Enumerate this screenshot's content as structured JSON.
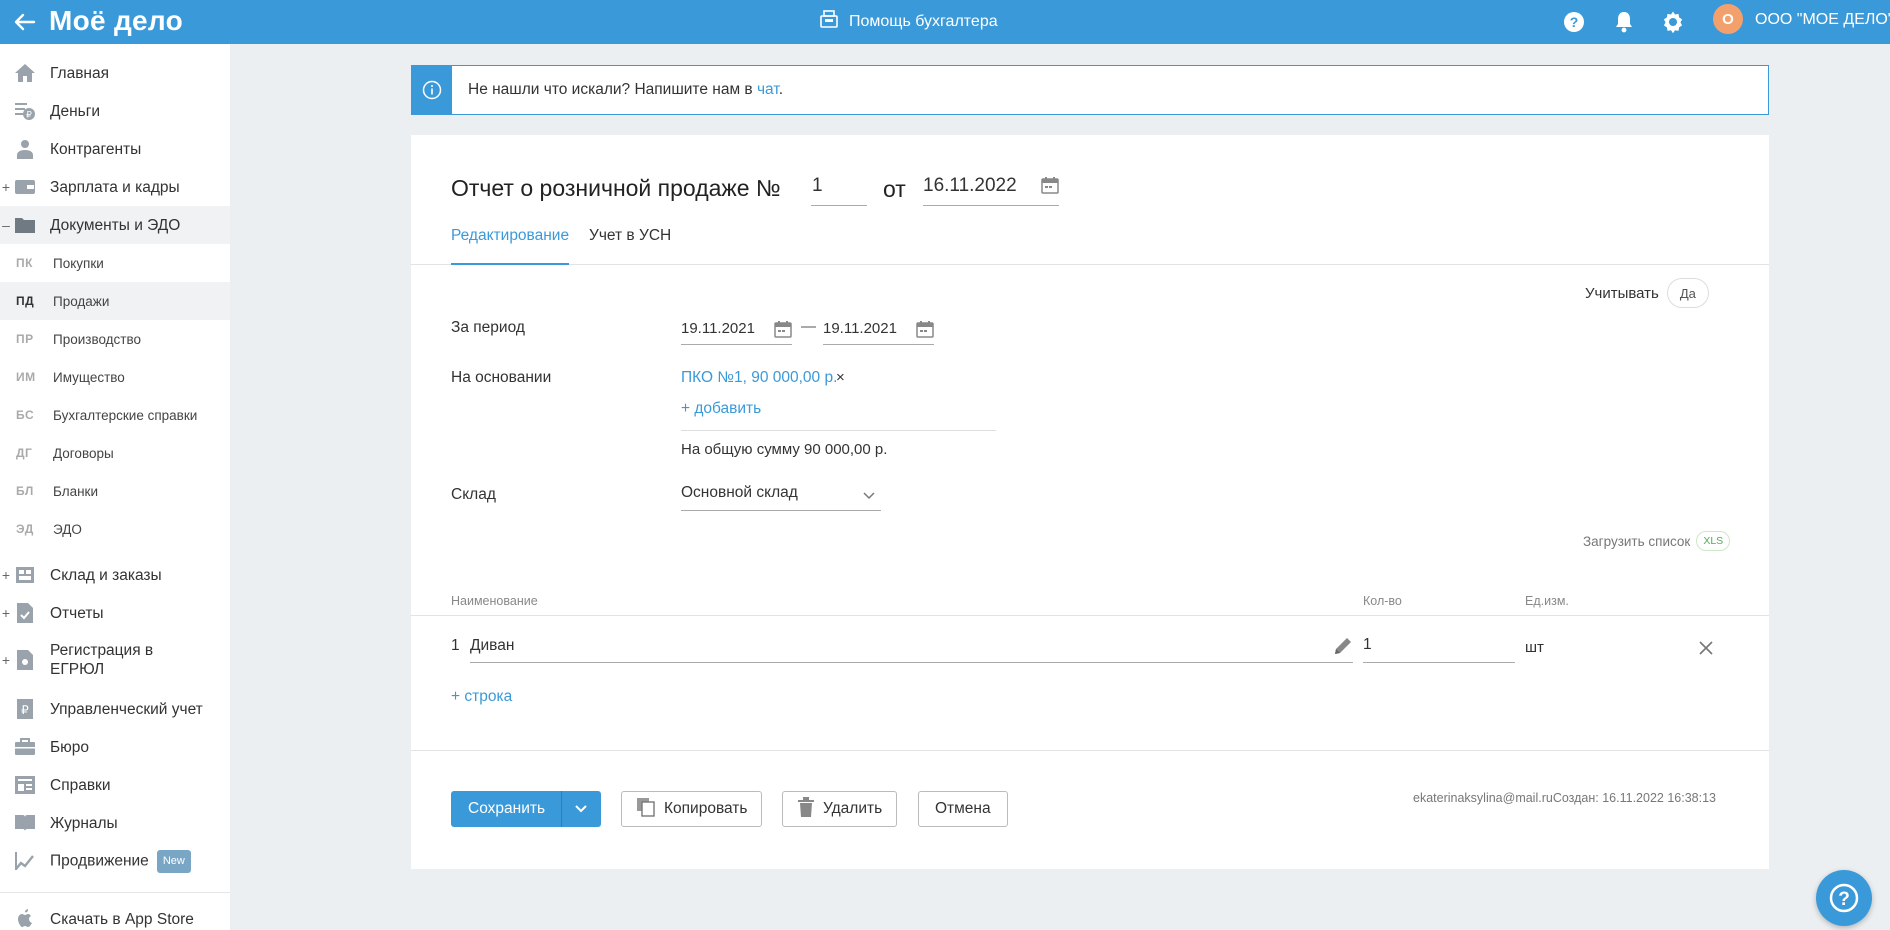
{
  "header": {
    "logo_text": "Моё дело",
    "help_center_label": "Помощь бухгалтера",
    "org_initial": "О",
    "org_name": "ООО \"МОЕ ДЕЛО\"",
    "colors": {
      "topbar": "#3a9ad9",
      "avatar": "#f4a06c"
    }
  },
  "sidebar": {
    "items": [
      {
        "label": "Главная",
        "icon": "home-icon",
        "expandable": false
      },
      {
        "label": "Деньги",
        "icon": "money-icon",
        "expandable": false
      },
      {
        "label": "Контрагенты",
        "icon": "contractors-icon",
        "expandable": false
      },
      {
        "label": "Зарплата и кадры",
        "icon": "wallet-icon",
        "expandable": true
      },
      {
        "label": "Документы и ЭДО",
        "icon": "folder-icon",
        "expandable": true,
        "expanded": true
      }
    ],
    "sub_items": [
      {
        "abbr": "ПК",
        "label": "Покупки"
      },
      {
        "abbr": "ПД",
        "label": "Продажи",
        "active": true
      },
      {
        "abbr": "ПР",
        "label": "Производство"
      },
      {
        "abbr": "ИМ",
        "label": "Имущество"
      },
      {
        "abbr": "БС",
        "label": "Бухгалтерские справки"
      },
      {
        "abbr": "ДГ",
        "label": "Договоры"
      },
      {
        "abbr": "БЛ",
        "label": "Бланки"
      },
      {
        "abbr": "ЭД",
        "label": "ЭДО"
      }
    ],
    "items_bottom": [
      {
        "label": "Склад и заказы",
        "icon": "warehouse-icon",
        "expandable": true
      },
      {
        "label": "Отчеты",
        "icon": "reports-icon",
        "expandable": true
      },
      {
        "label": "Регистрация в ЕГРЮЛ",
        "icon": "registration-icon",
        "expandable": true
      },
      {
        "label": "Управленческий учет",
        "icon": "ruble-doc-icon",
        "expandable": false
      },
      {
        "label": "Бюро",
        "icon": "briefcase-icon",
        "expandable": false
      },
      {
        "label": "Справки",
        "icon": "info-doc-icon",
        "expandable": false
      },
      {
        "label": "Журналы",
        "icon": "journal-icon",
        "expandable": false
      },
      {
        "label": "Продвижение",
        "icon": "promotion-icon",
        "expandable": false,
        "badge": "New"
      }
    ],
    "app_store_label": "Скачать в App Store"
  },
  "banner": {
    "text_before": "Не нашли что искали? Напишите нам в ",
    "link": "чат",
    "text_after": "."
  },
  "document": {
    "title": "Отчет о розничной продаже №",
    "number": "1",
    "from_label": "от",
    "date": "16.11.2022",
    "tabs": [
      {
        "label": "Редактирование",
        "active": true
      },
      {
        "label": "Учет в УСН",
        "active": false
      }
    ],
    "consider_label": "Учитывать",
    "consider_value": "Да",
    "period_label": "За период",
    "period_from": "19.11.2021",
    "period_to": "19.11.2021",
    "period_dash": "—",
    "basis_label": "На основании",
    "basis_link": "ПКО №1, 90 000,00 р.",
    "basis_remove": "×",
    "add_basis": "+ добавить",
    "total_text": "На общую сумму 90 000,00 р.",
    "warehouse_label": "Склад",
    "warehouse_value": "Основной склад",
    "load_list_label": "Загрузить список",
    "load_list_badge": "XLS",
    "table": {
      "headers": {
        "name": "Наименование",
        "qty": "Кол-во",
        "unit": "Ед.изм."
      },
      "rows": [
        {
          "num": "1",
          "name": "Диван",
          "qty": "1",
          "unit": "шт"
        }
      ],
      "add_row": "+ строка"
    },
    "buttons": {
      "save": "Сохранить",
      "copy": "Копировать",
      "delete": "Удалить",
      "cancel": "Отмена"
    },
    "meta": "ekaterinaksylina@mail.ruСоздан: 16.11.2022 16:38:13"
  }
}
